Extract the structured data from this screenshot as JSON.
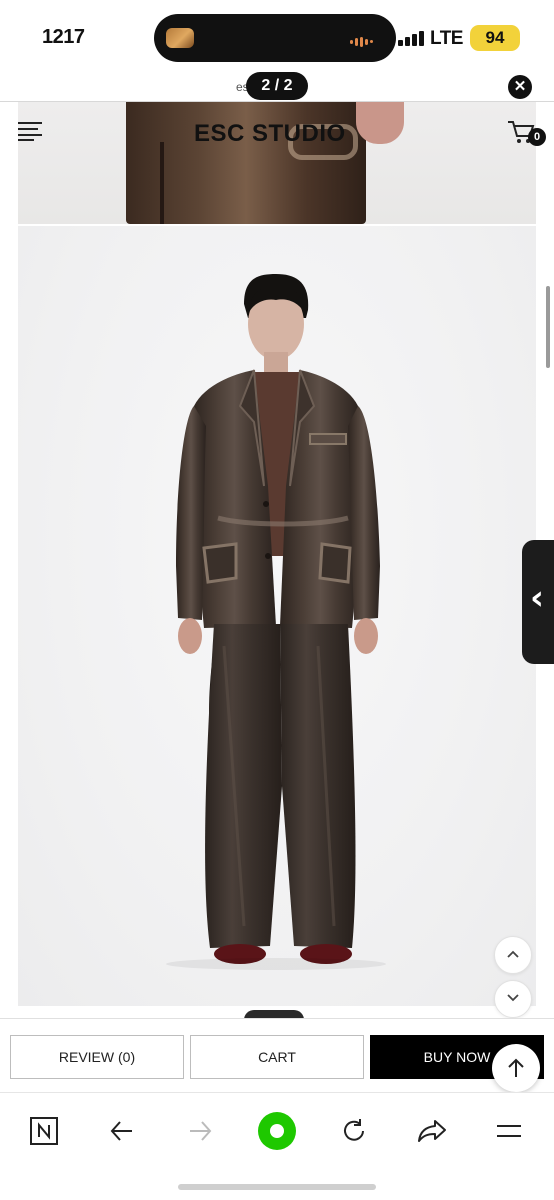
{
  "status_bar": {
    "time": "1217",
    "network": "LTE",
    "battery": "94"
  },
  "browser": {
    "url": "esc...kr",
    "page_counter": "2 / 2",
    "close_label": "✕"
  },
  "site": {
    "brand": "ESC STUDIO",
    "cart_count": "0"
  },
  "purchase_bar": {
    "review_label": "REVIEW (0)",
    "cart_label": "CART",
    "buy_now_label": "BUY NOW"
  },
  "icons": {
    "menu": "hamburger-icon",
    "cart": "cart-icon",
    "side_tab": "chevron-left-icon",
    "page_up": "chevron-up-icon",
    "page_down": "chevron-down-icon",
    "scroll_top": "arrow-up-icon",
    "nav": [
      "naver-icon",
      "back-arrow-icon",
      "forward-arrow-icon",
      "green-dot-icon",
      "refresh-icon",
      "share-icon",
      "menu-lines-icon"
    ]
  },
  "colors": {
    "accent_green": "#1ec800",
    "buy_now_bg": "#000000",
    "battery_badge": "#f2d23a"
  }
}
